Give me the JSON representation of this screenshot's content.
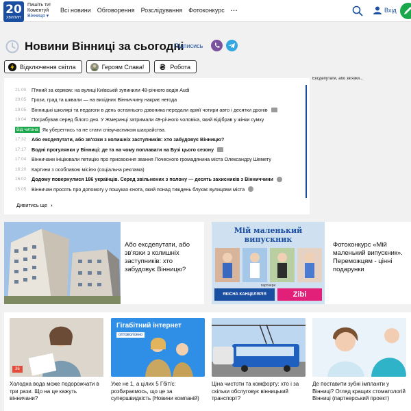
{
  "header": {
    "logo_number": "20",
    "logo_sub": "ХВИЛИН",
    "tagline_line1": "Пишіть ти!",
    "tagline_line2": "Коментуй",
    "city": "Вінниця",
    "nav": [
      "Всі новини",
      "Обговорення",
      "Розслідування",
      "Фотоконкурс"
    ],
    "more": "...",
    "login": "Вхід"
  },
  "page": {
    "title": "Новини Вінниці за сьогодні",
    "subscribe": "Підписись"
  },
  "chips": [
    "Відключення світла",
    "Героям Слава!",
    "Робота"
  ],
  "feed": {
    "items": [
      {
        "time": "21:00",
        "text": "П'яний за кермом: на вулиці Київській зупинили 48-річного водія Audi",
        "bold": false,
        "badge": "",
        "media": ""
      },
      {
        "time": "20:05",
        "text": "Грози, град та шквали — на вихідних Вінниччину накриє негода",
        "bold": false,
        "badge": "",
        "media": ""
      },
      {
        "time": "19:05",
        "text": "Вінницькі школярі та педагоги в день останнього дзвоника передали армії чотири авто і десятки дронів",
        "bold": false,
        "badge": "",
        "media": "photo"
      },
      {
        "time": "18:04",
        "text": "Пограбував серед білого дня. У Жмеринці затримали 49-річного чоловіка, який відібрав у жінки сумку",
        "bold": false,
        "badge": "",
        "media": ""
      },
      {
        "time": "",
        "text": "Як уберегтись та не стати співучасником шахрайства.",
        "bold": false,
        "badge": "Від читача",
        "media": ""
      },
      {
        "time": "17:32",
        "text": "Або ексдепутати, або зв'язки з колишніх заступників: хто забудовує Вінницю?",
        "bold": true,
        "badge": "",
        "media": ""
      },
      {
        "time": "17:17",
        "text": "Водні прогулянки у Вінниці: де та на чому поплавати на Бузі цього сезону",
        "bold": true,
        "badge": "",
        "media": "photo"
      },
      {
        "time": "17:04",
        "text": "Вінничани ініціювали петицію про присвоєння звання Почесного громадянина міста Олександру Шемету",
        "bold": false,
        "badge": "",
        "media": ""
      },
      {
        "time": "16:20",
        "text": "Картини з особливою місією (соціальна реклама)",
        "bold": false,
        "badge": "",
        "media": ""
      },
      {
        "time": "16:02",
        "text": "Додому повернулися 186 українців. Серед звільнених з полону — десять захисників з Вінниччини",
        "bold": true,
        "badge": "",
        "media": "video"
      },
      {
        "time": "15:05",
        "text": "Вінничан просять про допомогу у пошуках єнота, який понад тиждень блукає вулицями міста",
        "bold": false,
        "badge": "",
        "media": "video"
      }
    ],
    "see_more": "Дивитись ще"
  },
  "peek_text": "Ексдепутати, або зв'язки...",
  "cards": [
    {
      "text": "Або ексдепутати, або зв'язки з колишніх заступників: хто забудовує Вінницю?"
    },
    {
      "text": "Фотоконкурс «Мій маленький випускник». Переможцям - цінні подарунки",
      "banner_title_1": "Мій маленький",
      "banner_title_2": "випускник",
      "partners_label": "партнери",
      "partner1": "ЯКІСНА КАНЦЕЛЯРІЯ",
      "partner2": "Zibi"
    }
  ],
  "grid": [
    {
      "text": "Холодна вода може подорожчати в три рази. Що на це кажуть вінничани?",
      "badge": "36"
    },
    {
      "text": "Уже не 1, а цілих 5 Гбіт/с: розбираємось, що це за супершвидкість (Новини компаній)",
      "promo_1": "Гігабітний інтернет",
      "promo_2": "оптоволокно"
    },
    {
      "text": "Ціна чистоти та комфорту: хто і за скільки обслуговує вінницький транспорт?"
    },
    {
      "text": "Де поставити зубні імпланти у Вінниці? Огляд кращих стоматологій Вінниці (партнерський проект)"
    }
  ],
  "colors": {
    "brand": "#1a4ea1",
    "accent_green": "#1aa84a",
    "viber": "#7b519d",
    "telegram": "#34a7e0"
  }
}
